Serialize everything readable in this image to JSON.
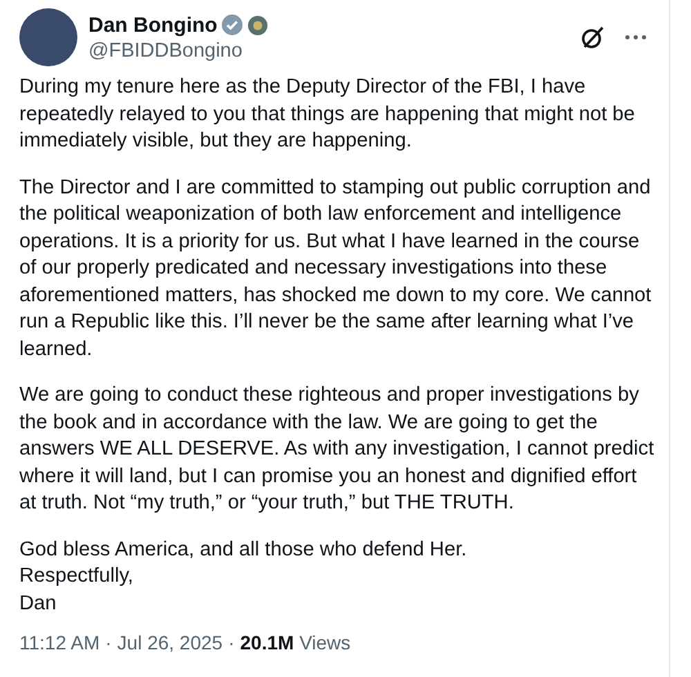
{
  "author": {
    "name": "Dan Bongino",
    "handle": "@FBIDDBongino",
    "verified": true
  },
  "paragraphs": [
    "During my tenure here as the Deputy Director of the FBI, I have repeatedly relayed to you that things are happening that might not be immediately visible, but they are happening.",
    "The Director and I are committed to stamping out public corruption and the political weaponization of both law enforcement and intelligence operations. It is a priority for us. But what I have learned in the course of our properly predicated and necessary investigations into these aforementioned matters, has shocked me down to my core. We cannot run a Republic like this. I’ll never be the same after learning what I’ve learned.",
    "We are going to conduct these righteous and proper investigations by the book and in accordance with the law. We are going to get the answers WE ALL DESERVE. As with any investigation, I cannot predict where it will land, but I can promise you an honest and dignified effort at truth. Not “my truth,” or “your truth,” but THE TRUTH.",
    "God bless America, and all those who defend Her.\nRespectfully,\nDan"
  ],
  "footer": {
    "time": "11:12 AM",
    "separator_1": "·",
    "date": "Jul 26, 2025",
    "separator_2": "·",
    "views_count": "20.1M",
    "views_label": "Views"
  }
}
